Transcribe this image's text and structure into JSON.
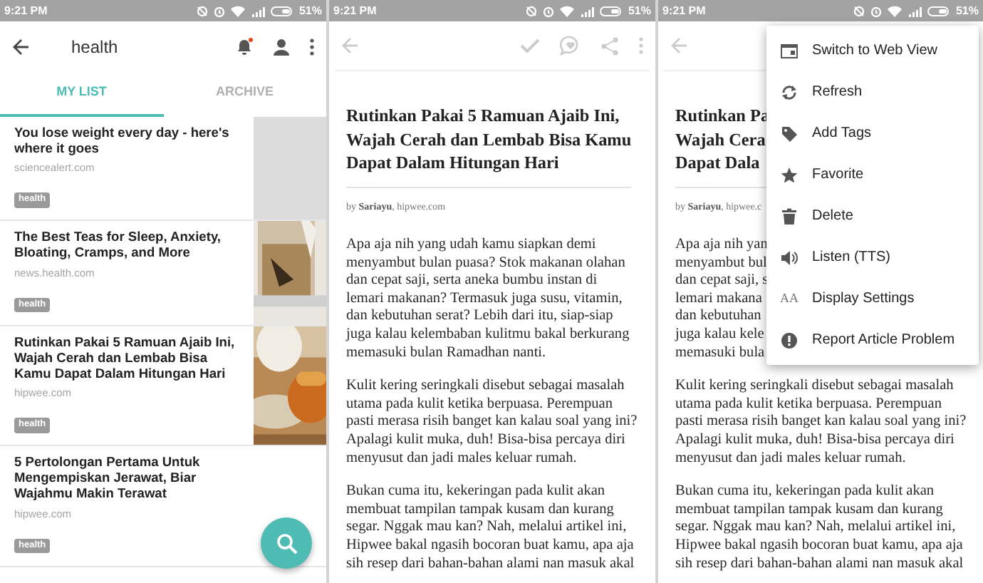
{
  "screens": [
    {
      "kind": "list",
      "status_bar": {
        "time": "9:21 PM",
        "battery": "51%"
      },
      "toolbar": {
        "title": "health",
        "notification_dot": true
      },
      "tabs": [
        {
          "label": "MY LIST",
          "selected": true
        },
        {
          "label": "ARCHIVE",
          "selected": false
        }
      ],
      "items": [
        {
          "title": "You lose weight every day - here's where it goes",
          "source": "sciencealert.com",
          "tag": "health",
          "kind": "placeholder"
        },
        {
          "title": "The Best Teas for Sleep, Anxiety, Bloating, Cramps, and More",
          "source": "news.health.com",
          "tag": "health",
          "kind": "picture"
        },
        {
          "title": "Rutinkan Pakai 5 Ramuan Ajaib Ini, Wajah Cerah dan Lembab Bisa Kamu Dapat Dalam Hitungan Hari",
          "source": "hipwee.com",
          "tag": "health",
          "kind": "picture"
        },
        {
          "title": "5 Pertolongan Pertama Untuk Mengempiskan Jerawat, Biar Wajahmu Makin Terawat",
          "source": "hipwee.com",
          "tag": "health",
          "kind": "text"
        }
      ]
    },
    {
      "kind": "article",
      "status_bar": {
        "time": "9:21 PM",
        "battery": "51%"
      },
      "title_lines": [
        "Rutinkan Pakai 5 Ramuan Ajaib Ini,",
        "Wajah Cerah dan Lembab Bisa Kamu",
        "Dapat Dalam Hitungan Hari"
      ],
      "byline": "by **Sariayu**, hipwee.com",
      "paragraphs": [
        {
          "lines": [
            "Apa aja nih yang udah kamu siapkan demi",
            "menyambut bulan puasa? Stok makanan olahan",
            "dan cepat saji, serta aneka bumbu instan di",
            "lemari makanan? Termasuk juga susu, vitamin,",
            "dan kebutuhan serat? Lebih dari itu, siap-siap",
            "juga kalau kelembaban kulitmu bakal berkurang",
            "memasuki bulan Ramadhan nanti."
          ]
        },
        {
          "lines": [
            "Kulit kering seringkali disebut sebagai masalah",
            "utama pada kulit ketika berpuasa. Perempuan",
            "pasti merasa risih banget kan kalau soal yang ini?",
            "Apalagi kulit muka, duh! Bisa-bisa percaya diri",
            "menyusut dan jadi males keluar rumah."
          ]
        },
        {
          "lines": [
            "Bukan cuma itu, kekeringan pada kulit akan",
            "membuat tampilan tampak kusam dan kurang",
            "segar. Nggak mau kan? Nah, melalui artikel ini,",
            "Hipwee bakal ngasih bocoran buat kamu, apa aja",
            "sih resep dari bahan-bahan alami nan masuk akal"
          ]
        }
      ]
    },
    {
      "kind": "article",
      "status_bar": {
        "time": "9:21 PM",
        "battery": "51%"
      },
      "title_lines": [
        "Rutinkan Pa",
        "Wajah Cera",
        "Dapat Dala"
      ],
      "byline": "by **Sariayu**, hipwee.c",
      "paragraphs": [
        {
          "lines": [
            "Apa aja nih yan",
            "menyambut bul",
            "dan cepat saji, s",
            "lemari makana",
            "dan kebutuhan",
            "juga kalau kele",
            "memasuki bula"
          ]
        },
        {
          "lines": [
            "Kulit kering seringkali disebut sebagai masalah",
            "utama pada kulit ketika berpuasa. Perempuan",
            "pasti merasa risih banget kan kalau soal yang ini?",
            "Apalagi kulit muka, duh! Bisa-bisa percaya diri",
            "menyusut dan jadi males keluar rumah."
          ]
        },
        {
          "lines": [
            "Bukan cuma itu, kekeringan pada kulit akan",
            "membuat tampilan tampak kusam dan kurang",
            "segar. Nggak mau kan? Nah, melalui artikel ini,",
            "Hipwee bakal ngasih bocoran buat kamu, apa aja",
            "sih resep dari bahan-bahan alami nan masuk akal"
          ]
        }
      ],
      "menu": [
        {
          "label": "Switch to Web View"
        },
        {
          "label": "Refresh"
        },
        {
          "label": "Add Tags"
        },
        {
          "label": "Favorite"
        },
        {
          "label": "Delete"
        },
        {
          "label": "Listen (TTS)"
        },
        {
          "label": "Display Settings",
          "icon_text": "AA"
        },
        {
          "label": "Report Article Problem"
        }
      ]
    }
  ]
}
